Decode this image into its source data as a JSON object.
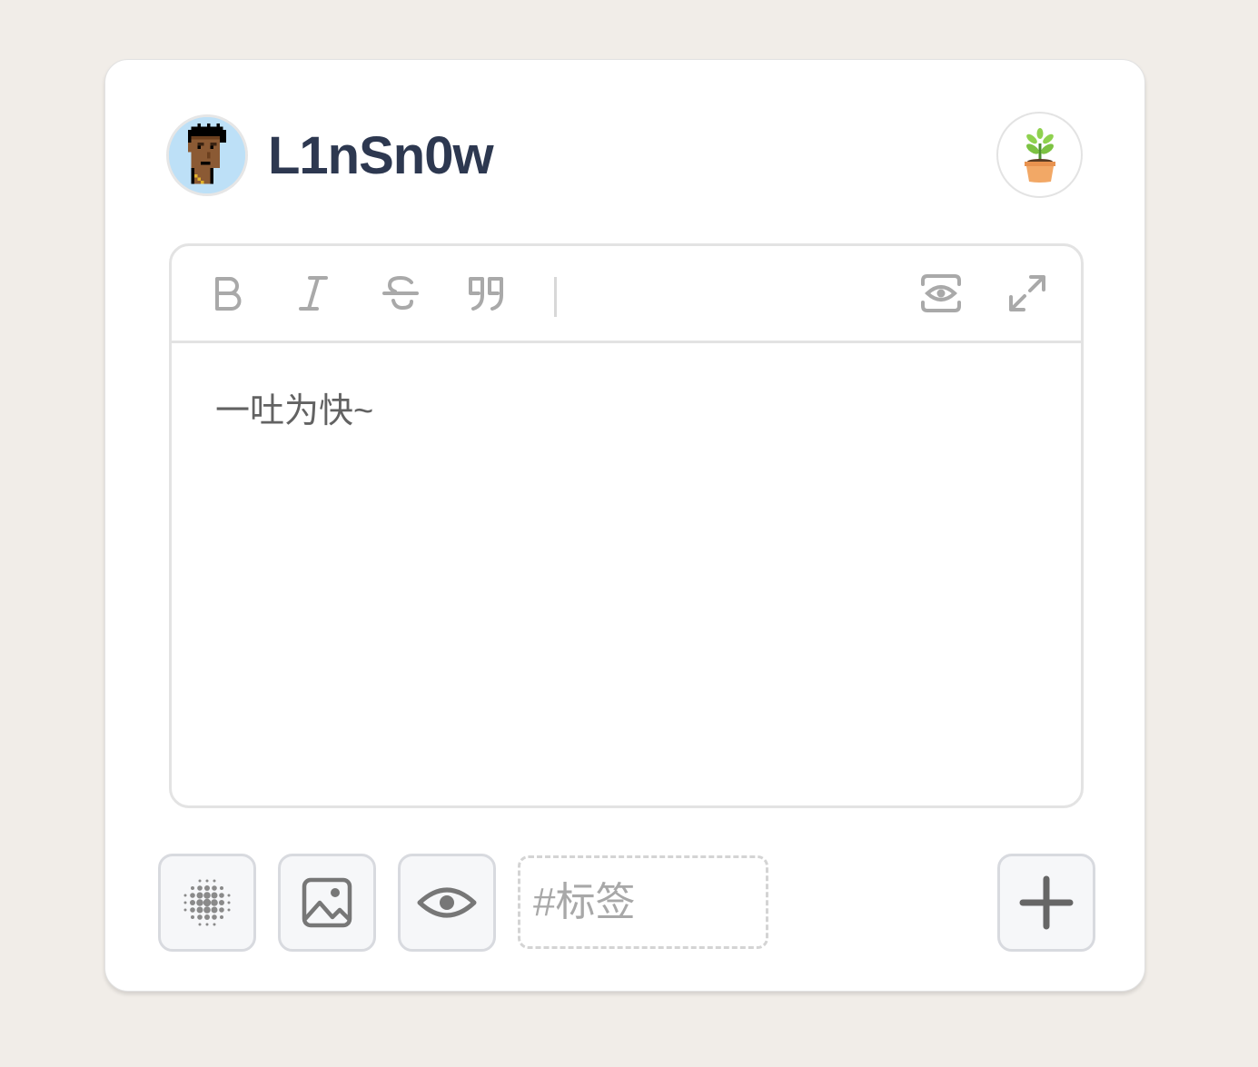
{
  "user": {
    "name": "L1nSn0w",
    "avatar_icon": "pixel-punk-avatar"
  },
  "header": {
    "action_icon": "potted-plant-icon"
  },
  "editor": {
    "toolbar": {
      "left_tools": [
        "bold-icon",
        "italic-icon",
        "strikethrough-icon",
        "quote-icon"
      ],
      "right_tools": [
        "preview-icon",
        "fullscreen-icon"
      ]
    },
    "placeholder": "一吐为快~"
  },
  "footer": {
    "buttons": [
      "mood-dots-icon",
      "image-icon",
      "visibility-icon"
    ],
    "tag_placeholder": "#标签",
    "submit_icon": "plus-icon"
  },
  "colors": {
    "background": "#f1ede8",
    "card": "#ffffff",
    "username": "#2d3850",
    "icon_gray": "#a9a9a9"
  }
}
